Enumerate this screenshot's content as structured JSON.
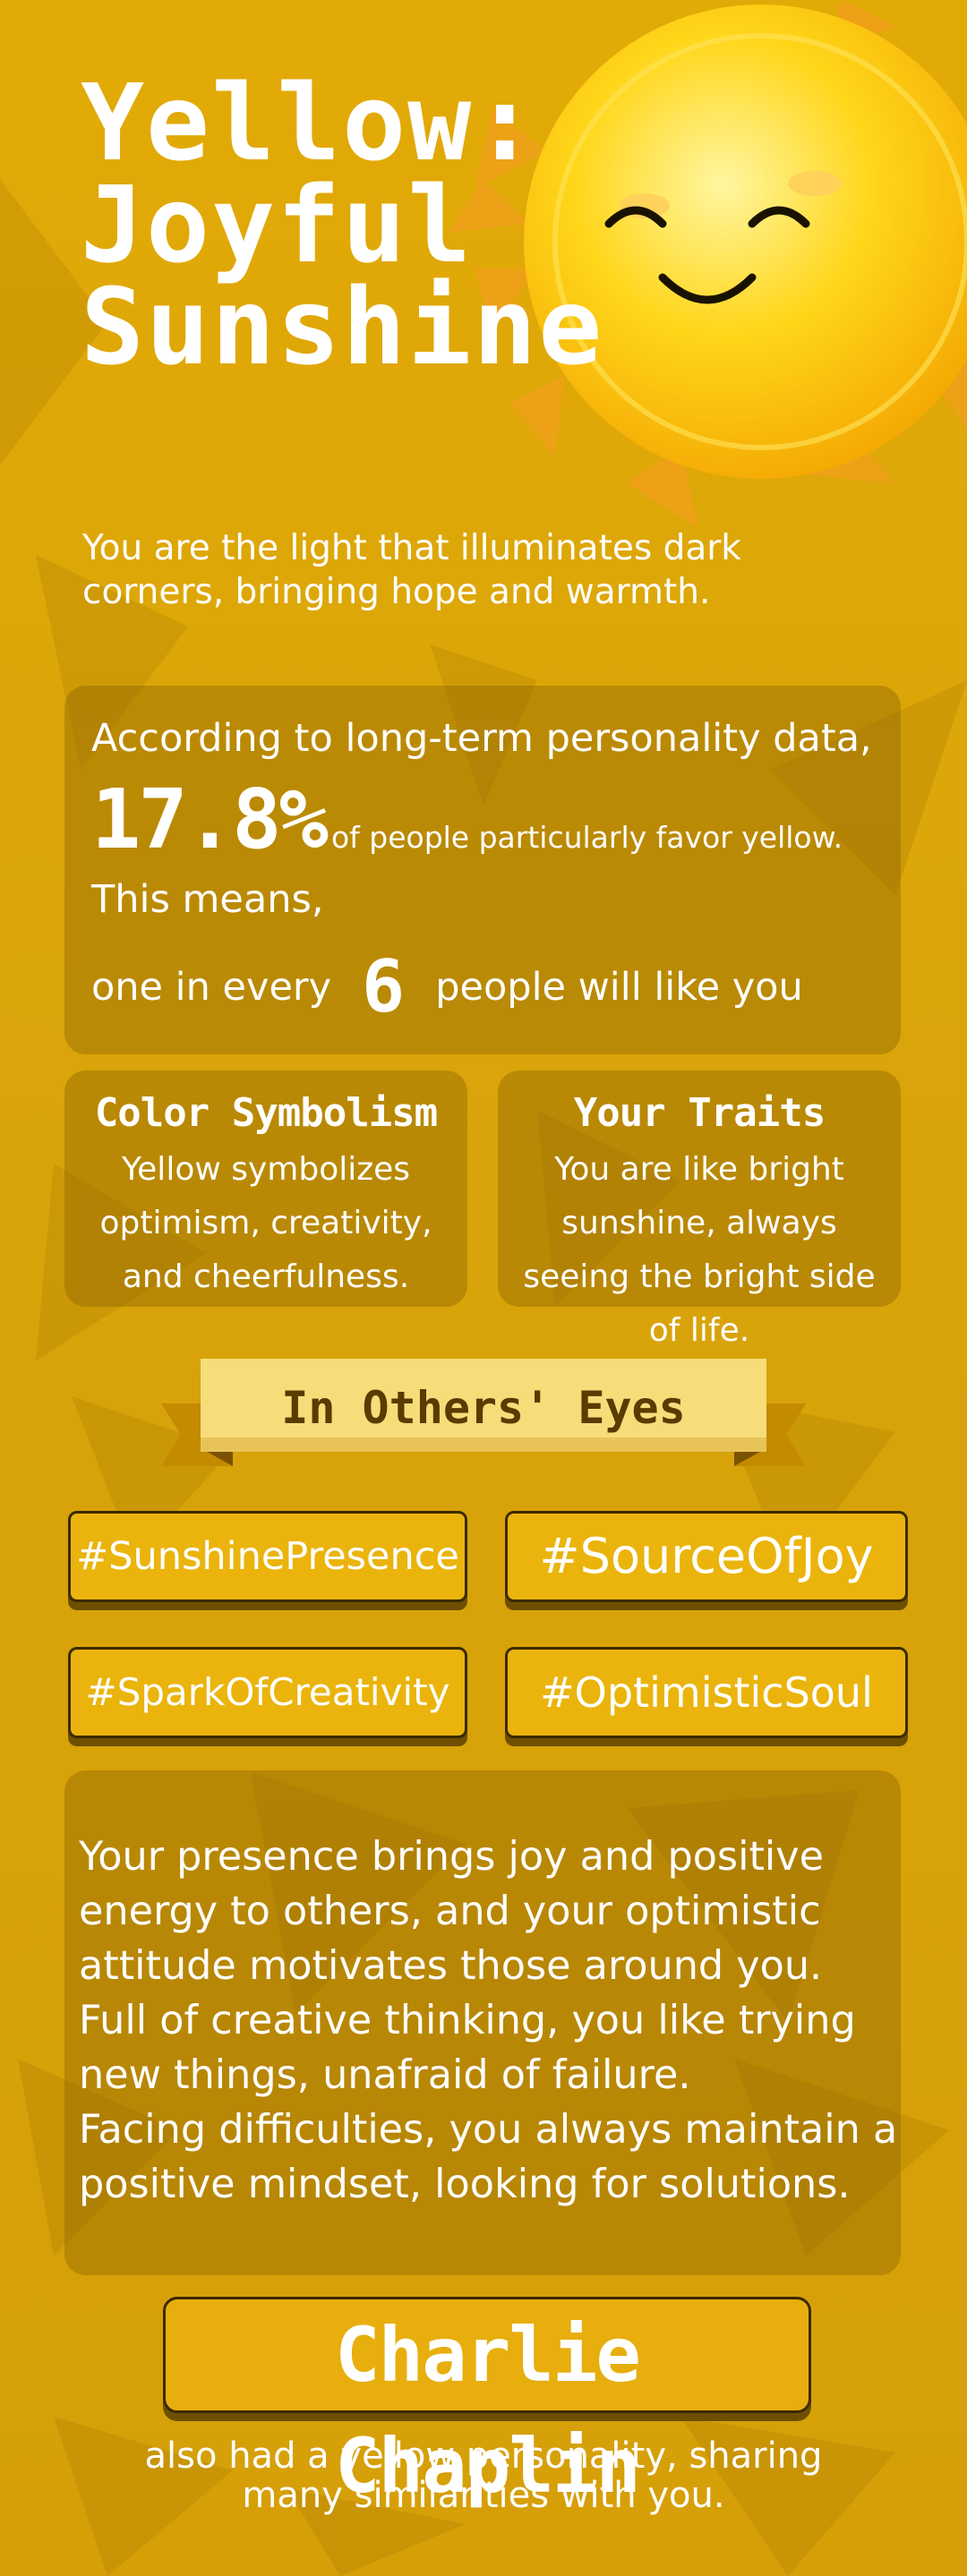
{
  "colors": {
    "background": "#e2aa06",
    "panel": "#8c6400",
    "tag": "#eab40c",
    "ribbon": "#f6dd7a",
    "text": "#ffffff"
  },
  "header": {
    "title_lines": [
      "Yellow:",
      "Joyful",
      "Sunshine"
    ],
    "subtitle": "You are the light that illuminates dark corners, bringing hope and warmth.",
    "sun_icon": "smiling-sun-icon"
  },
  "stats": {
    "line1": "According to long-term personality data,",
    "percent": "17.8%",
    "percent_suffix": "of people particularly favor yellow.",
    "line3": "This means,",
    "line4_prefix": "one in every",
    "number": "6",
    "line4_suffix": "people will like you"
  },
  "cards": [
    {
      "title": "Color Symbolism",
      "text": "Yellow symbolizes optimism, creativity, and cheerfulness."
    },
    {
      "title": "Your Traits",
      "text": "You are like bright sunshine, always seeing the bright side of life."
    }
  ],
  "ribbon": {
    "label": "In Others' Eyes"
  },
  "tags": [
    "#SunshinePresence",
    "#SourceOfJoy",
    "#SparkOfCreativity",
    "#OptimisticSoul"
  ],
  "paragraph": "Your presence brings joy and positive energy to others, and your optimistic attitude motivates those around you.\nFull of creative thinking, you like trying new things, unafraid of failure.\nFacing difficulties, you always maintain a positive mindset, looking for solutions.",
  "celebrity": {
    "name": "Charlie Chaplin",
    "caption": "also had a yellow personality, sharing many similarities with you."
  }
}
